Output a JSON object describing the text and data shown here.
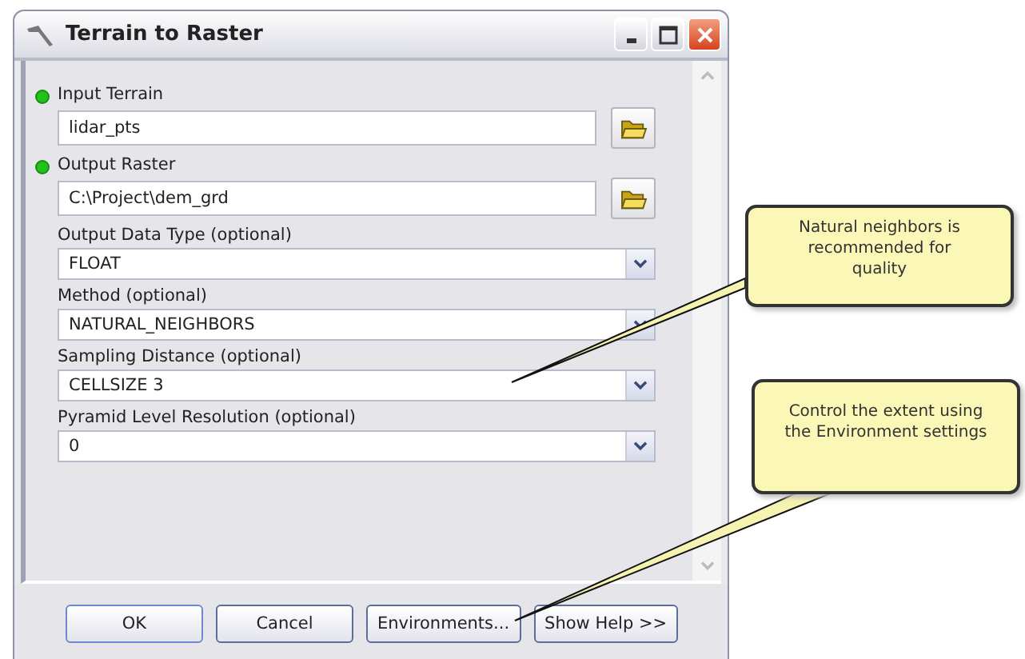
{
  "window": {
    "title": "Terrain to Raster"
  },
  "parameters": [
    {
      "kind": "file",
      "label": "Input Terrain",
      "required": true,
      "value": "lidar_pts"
    },
    {
      "kind": "file",
      "label": "Output Raster",
      "required": true,
      "value": "C:\\Project\\dem_grd"
    },
    {
      "kind": "dropdown",
      "label": "Output Data Type (optional)",
      "required": false,
      "value": "FLOAT"
    },
    {
      "kind": "dropdown",
      "label": "Method (optional)",
      "required": false,
      "value": "NATURAL_NEIGHBORS"
    },
    {
      "kind": "dropdown",
      "label": "Sampling Distance (optional)",
      "required": false,
      "value": "CELLSIZE 3"
    },
    {
      "kind": "dropdown",
      "label": "Pyramid Level Resolution (optional)",
      "required": false,
      "value": "0"
    }
  ],
  "buttons": [
    "OK",
    "Cancel",
    "Environments...",
    "Show Help >>"
  ],
  "callouts": [
    {
      "text": "Natural neighbors is recommended for quality"
    },
    {
      "text": "Control the extent using the Environment settings"
    }
  ]
}
